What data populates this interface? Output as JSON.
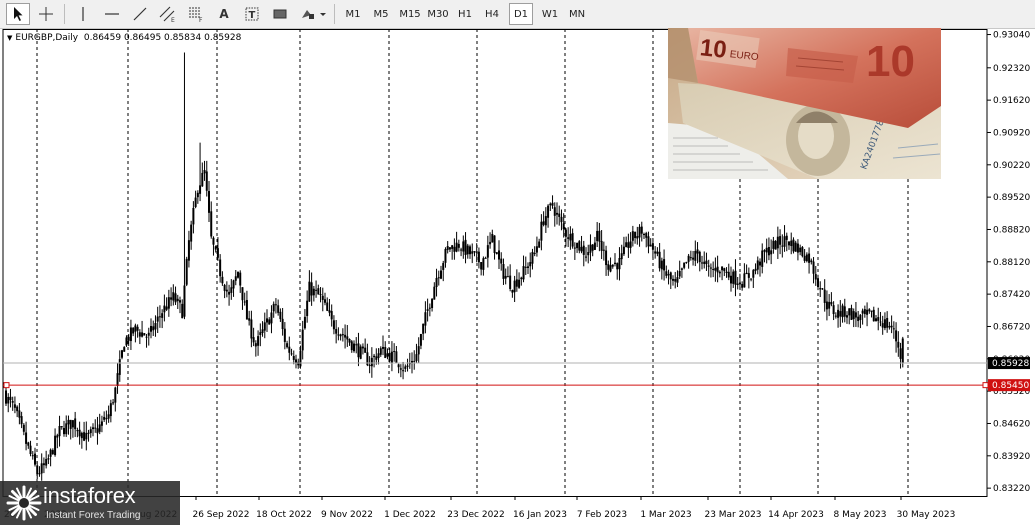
{
  "toolbar": {
    "tools": [
      {
        "name": "cursor-icon"
      },
      {
        "name": "crosshair-icon"
      },
      {
        "name": "vertical-line-icon"
      },
      {
        "name": "horizontal-line-icon"
      },
      {
        "name": "trendline-icon"
      },
      {
        "name": "equidistant-channel-icon"
      },
      {
        "name": "fibonacci-icon"
      },
      {
        "name": "text-icon",
        "label": "A"
      },
      {
        "name": "text-label-icon"
      },
      {
        "name": "rectangle-icon"
      },
      {
        "name": "shapes-dropdown-icon"
      }
    ],
    "timeframes": [
      "M1",
      "M5",
      "M15",
      "M30",
      "H1",
      "H4",
      "D1",
      "W1",
      "MN"
    ],
    "active_timeframe": "D1"
  },
  "chart_header": {
    "symbol": "EURGBP,Daily",
    "ohlc": "0.86459 0.86495 0.85834 0.85928"
  },
  "logo": {
    "name": "instaforex",
    "tagline": "Instant Forex Trading"
  },
  "banknote": {
    "denomination": "10",
    "currency": "EURO",
    "serial": "KA24017782"
  },
  "colors": {
    "candle": "#000000",
    "grid": "#000000",
    "support_line": "#d01010",
    "current_price_line": "#b0b0b0",
    "price_label_bg": "#000000",
    "support_label_bg": "#d01010"
  },
  "chart_data": {
    "type": "candlestick",
    "symbol": "EURGBP",
    "timeframe": "Daily",
    "y_ticks": [
      "0.93040",
      "0.92320",
      "0.91620",
      "0.90920",
      "0.90220",
      "0.89520",
      "0.88820",
      "0.88120",
      "0.87420",
      "0.86720",
      "0.86020",
      "0.85320",
      "0.84620",
      "0.83920",
      "0.83220"
    ],
    "ylim": [
      0.8305,
      0.9316
    ],
    "x_labels": [
      "26 Sep 2022",
      "18 Oct 2022",
      "9 Nov 2022",
      "1 Dec 2022",
      "23 Dec 2022",
      "16 Jan 2023",
      "7 Feb 2023",
      "1 Mar 2023",
      "23 Mar 2023",
      "14 Apr 2023",
      "8 May 2023",
      "30 May 2023"
    ],
    "x_label_partial": [
      "20",
      "2022",
      "ug 2022"
    ],
    "vertical_separators": 11,
    "current_price": {
      "label": "0.85928",
      "value": 0.85928
    },
    "support_level": {
      "label": "0.85450",
      "value": 0.8545
    },
    "ohlc_last": {
      "open": 0.86459,
      "high": 0.86495,
      "low": 0.85834,
      "close": 0.85928
    },
    "close_path": [
      [
        0,
        0.852
      ],
      [
        4,
        0.849
      ],
      [
        9,
        0.842
      ],
      [
        14,
        0.8355
      ],
      [
        18,
        0.8372
      ],
      [
        24,
        0.8445
      ],
      [
        30,
        0.8465
      ],
      [
        36,
        0.843
      ],
      [
        41,
        0.845
      ],
      [
        46,
        0.848
      ],
      [
        49,
        0.8535
      ],
      [
        53,
        0.864
      ],
      [
        58,
        0.8665
      ],
      [
        64,
        0.865
      ],
      [
        70,
        0.8705
      ],
      [
        75,
        0.8735
      ],
      [
        79,
        0.8705
      ],
      [
        82,
        0.8855
      ],
      [
        86,
        0.8975
      ],
      [
        89,
        0.9005
      ],
      [
        92,
        0.886
      ],
      [
        96,
        0.879
      ],
      [
        100,
        0.8735
      ],
      [
        104,
        0.879
      ],
      [
        108,
        0.869
      ],
      [
        112,
        0.863
      ],
      [
        116,
        0.867
      ],
      [
        121,
        0.872
      ],
      [
        126,
        0.8625
      ],
      [
        131,
        0.86
      ],
      [
        136,
        0.8755
      ],
      [
        141,
        0.8735
      ],
      [
        146,
        0.868
      ],
      [
        152,
        0.865
      ],
      [
        158,
        0.862
      ],
      [
        163,
        0.8595
      ],
      [
        168,
        0.862
      ],
      [
        174,
        0.8605
      ],
      [
        179,
        0.858
      ],
      [
        184,
        0.861
      ],
      [
        188,
        0.869
      ],
      [
        193,
        0.878
      ],
      [
        198,
        0.884
      ],
      [
        203,
        0.885
      ],
      [
        208,
        0.883
      ],
      [
        213,
        0.881
      ],
      [
        218,
        0.886
      ],
      [
        222,
        0.8795
      ],
      [
        227,
        0.876
      ],
      [
        232,
        0.879
      ],
      [
        237,
        0.883
      ],
      [
        241,
        0.8905
      ],
      [
        245,
        0.8935
      ],
      [
        250,
        0.888
      ],
      [
        255,
        0.8855
      ],
      [
        260,
        0.883
      ],
      [
        265,
        0.8865
      ],
      [
        270,
        0.8805
      ],
      [
        275,
        0.881
      ],
      [
        280,
        0.886
      ],
      [
        285,
        0.888
      ],
      [
        290,
        0.884
      ],
      [
        295,
        0.879
      ],
      [
        300,
        0.876
      ],
      [
        305,
        0.881
      ],
      [
        310,
        0.883
      ],
      [
        315,
        0.879
      ],
      [
        320,
        0.88
      ],
      [
        325,
        0.878
      ],
      [
        330,
        0.877
      ],
      [
        335,
        0.879
      ],
      [
        340,
        0.883
      ],
      [
        345,
        0.885
      ],
      [
        350,
        0.886
      ],
      [
        355,
        0.884
      ],
      [
        360,
        0.882
      ],
      [
        364,
        0.877
      ],
      [
        368,
        0.872
      ],
      [
        372,
        0.87
      ],
      [
        377,
        0.8705
      ],
      [
        382,
        0.869
      ],
      [
        387,
        0.8695
      ],
      [
        392,
        0.8685
      ],
      [
        397,
        0.867
      ],
      [
        400,
        0.863
      ],
      [
        402,
        0.8593
      ]
    ]
  }
}
